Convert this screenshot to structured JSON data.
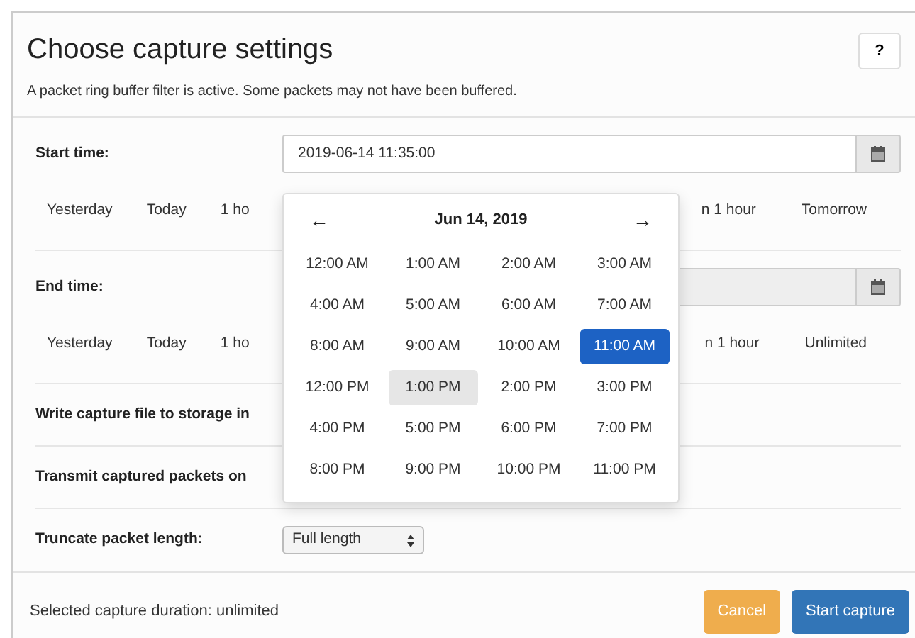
{
  "dialog": {
    "title": "Choose capture settings",
    "help_button": "?",
    "notice": "A packet ring buffer filter is active. Some packets may not have been buffered."
  },
  "start_time": {
    "label": "Start time:",
    "value": "2019-06-14 11:35:00",
    "quick_left": [
      "Yesterday",
      "Today",
      "1 ho"
    ],
    "quick_right": [
      "n 1 hour",
      "Tomorrow"
    ]
  },
  "end_time": {
    "label": "End time:",
    "quick_left": [
      "Yesterday",
      "Today",
      "1 ho"
    ],
    "quick_right": [
      "n 1 hour",
      "Unlimited"
    ]
  },
  "options": [
    {
      "label": "Write capture file to storage in",
      "kind": "text"
    },
    {
      "label": "Transmit captured packets on",
      "kind": "text"
    },
    {
      "label": "Truncate packet length:",
      "kind": "select",
      "value": "Full length"
    }
  ],
  "time_picker": {
    "prev": "←",
    "title": "Jun 14, 2019",
    "next": "→",
    "hours": [
      {
        "label": "12:00 AM",
        "selected": false,
        "hovered": false
      },
      {
        "label": "1:00 AM",
        "selected": false,
        "hovered": false
      },
      {
        "label": "2:00 AM",
        "selected": false,
        "hovered": false
      },
      {
        "label": "3:00 AM",
        "selected": false,
        "hovered": false
      },
      {
        "label": "4:00 AM",
        "selected": false,
        "hovered": false
      },
      {
        "label": "5:00 AM",
        "selected": false,
        "hovered": false
      },
      {
        "label": "6:00 AM",
        "selected": false,
        "hovered": false
      },
      {
        "label": "7:00 AM",
        "selected": false,
        "hovered": false
      },
      {
        "label": "8:00 AM",
        "selected": false,
        "hovered": false
      },
      {
        "label": "9:00 AM",
        "selected": false,
        "hovered": false
      },
      {
        "label": "10:00 AM",
        "selected": false,
        "hovered": false
      },
      {
        "label": "11:00 AM",
        "selected": true,
        "hovered": false
      },
      {
        "label": "12:00 PM",
        "selected": false,
        "hovered": false
      },
      {
        "label": "1:00 PM",
        "selected": false,
        "hovered": true
      },
      {
        "label": "2:00 PM",
        "selected": false,
        "hovered": false
      },
      {
        "label": "3:00 PM",
        "selected": false,
        "hovered": false
      },
      {
        "label": "4:00 PM",
        "selected": false,
        "hovered": false
      },
      {
        "label": "5:00 PM",
        "selected": false,
        "hovered": false
      },
      {
        "label": "6:00 PM",
        "selected": false,
        "hovered": false
      },
      {
        "label": "7:00 PM",
        "selected": false,
        "hovered": false
      },
      {
        "label": "8:00 PM",
        "selected": false,
        "hovered": false
      },
      {
        "label": "9:00 PM",
        "selected": false,
        "hovered": false
      },
      {
        "label": "10:00 PM",
        "selected": false,
        "hovered": false
      },
      {
        "label": "11:00 PM",
        "selected": false,
        "hovered": false
      }
    ]
  },
  "footer": {
    "duration": "Selected capture duration: unlimited",
    "buttons": [
      {
        "label": "Cancel",
        "kind": "warning"
      },
      {
        "label": "Start capture",
        "kind": "primary"
      }
    ]
  }
}
